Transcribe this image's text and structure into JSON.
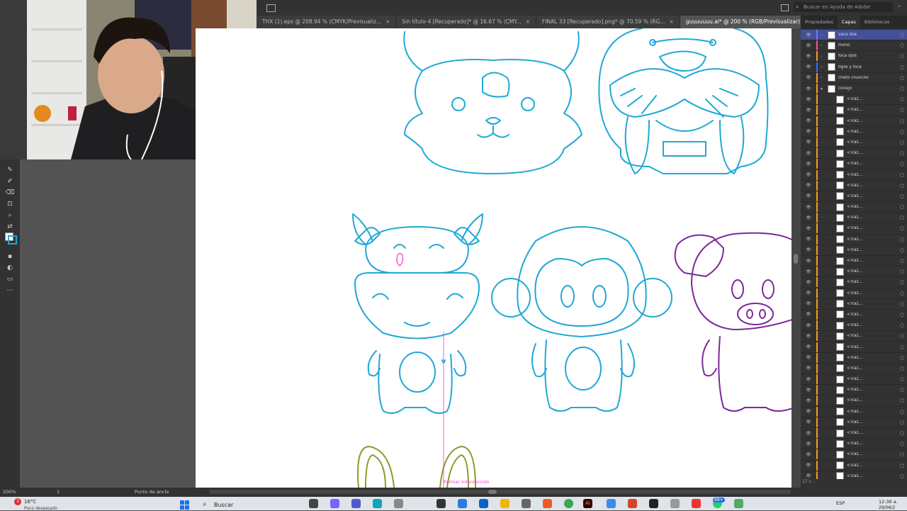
{
  "app": {
    "search_placeholder": "Buscar en Ayuda de Adobe"
  },
  "tabs": [
    {
      "label": "THX (1).eps @ 208.94 % (CMYK/Previsualiz..."
    },
    {
      "label": "Sin título-4 [Recuperado]* @ 16.67 % (CMY..."
    },
    {
      "label": "FINAL 33 [Recuperado].png* @ 70.59 % (RG..."
    },
    {
      "label": "guuuuuuu.ai* @ 200 % (RGB/Previsualizar)"
    }
  ],
  "panel": {
    "tabs": [
      "Propiedades",
      "Capas",
      "Bibliotecas"
    ],
    "active_tab": "Capas",
    "layers": [
      {
        "name": "vaca lola",
        "color": "#6e7dff"
      },
      {
        "name": "mono",
        "color": "#ff4da6"
      },
      {
        "name": "foca ojos",
        "color": "#ff9a1a"
      },
      {
        "name": "tigre y foca",
        "color": "#3a6cff"
      },
      {
        "name": "cheto chuncho",
        "color": "#ff9a1a"
      },
      {
        "name": "conejo",
        "color": "#ff9a1a"
      }
    ],
    "sublayer_label": "<Traz...",
    "layer_count": "17 c..."
  },
  "canvas": {
    "hint_text": "Formar intersección",
    "colors": {
      "cyan": "#1fa8d6",
      "purple": "#7b2a9a",
      "olive": "#8c9a2a",
      "magenta": "#ff2fd0"
    }
  },
  "status": {
    "zoom": "200%",
    "artboard": "1",
    "tool_info": "Punto de ancla"
  },
  "taskbar": {
    "weather_temp": "16°C",
    "weather_desc": "Poco despejado",
    "search_label": "Buscar",
    "lang": "ESP",
    "time": "12:36 a.",
    "date": "29/06/2",
    "notif_count": "3",
    "badge": "99+"
  }
}
